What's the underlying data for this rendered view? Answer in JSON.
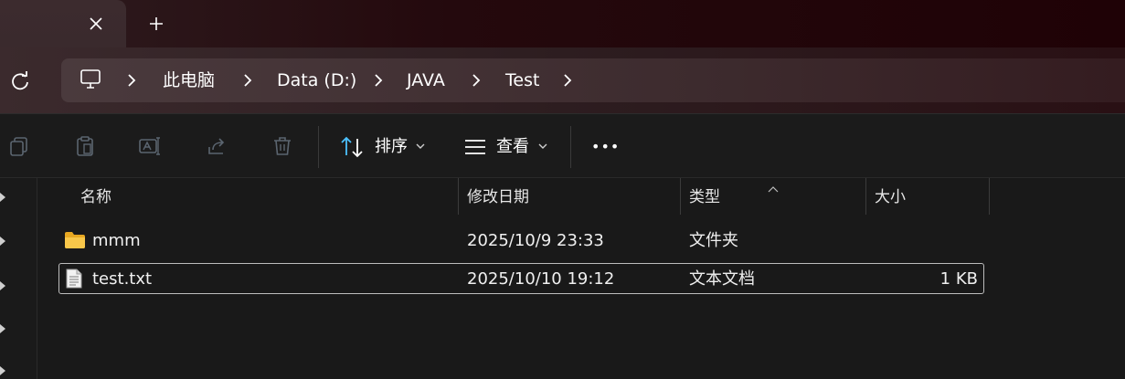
{
  "tab": {
    "close_glyph": "✕",
    "new_tab_glyph": "+"
  },
  "breadcrumb": {
    "items": [
      {
        "label": "此电脑"
      },
      {
        "label": "Data (D:)"
      },
      {
        "label": "JAVA"
      },
      {
        "label": "Test"
      }
    ]
  },
  "toolbar": {
    "sort_label": "排序",
    "view_label": "查看",
    "more_label": "•••",
    "icons": [
      "copy-icon",
      "paste-icon",
      "rename-icon",
      "share-icon",
      "delete-icon"
    ]
  },
  "columns": {
    "name": "名称",
    "date": "修改日期",
    "type": "类型",
    "size": "大小"
  },
  "files": [
    {
      "name": "mmm",
      "date": "2025/10/9 23:33",
      "type": "文件夹",
      "size": "",
      "icon": "folder-icon",
      "selected": false
    },
    {
      "name": "test.txt",
      "date": "2025/10/10 19:12",
      "type": "文本文档",
      "size": "1 KB",
      "icon": "text-file-icon",
      "selected": true
    }
  ],
  "colors": {
    "accent": "#4cc2ff",
    "folder": "#f8c74a"
  }
}
